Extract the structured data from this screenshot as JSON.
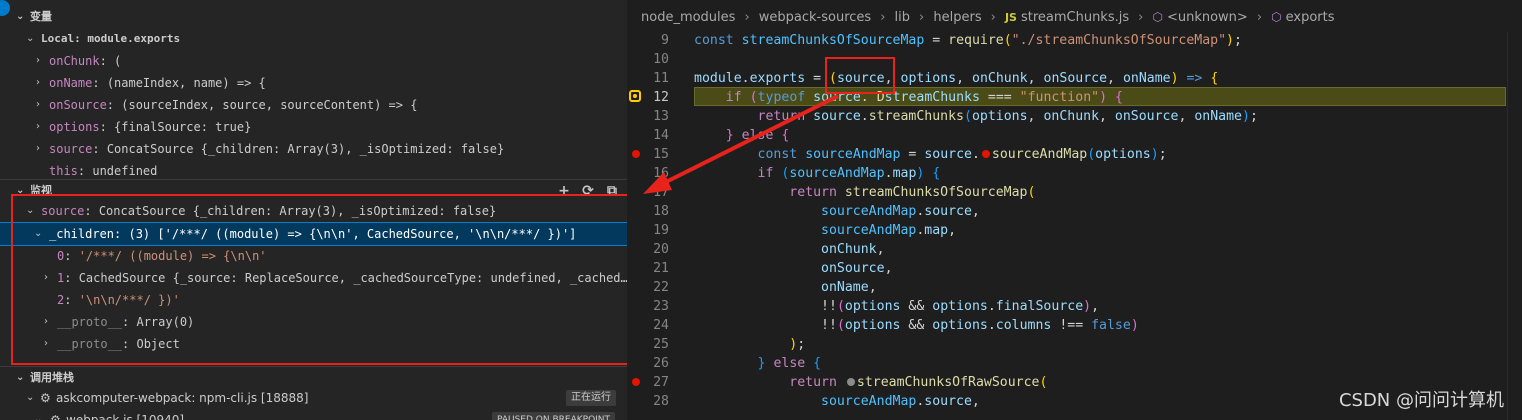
{
  "sidebar": {
    "variables": {
      "title": "变量",
      "scope": "Local: module.exports",
      "items": [
        {
          "name": "onChunk",
          "value": "("
        },
        {
          "name": "onName",
          "value": "(nameIndex, name) => {"
        },
        {
          "name": "onSource",
          "value": "(sourceIndex, source, sourceContent) => {"
        },
        {
          "name": "options",
          "value": "{finalSource: true}"
        },
        {
          "name": "source",
          "value": "ConcatSource {_children: Array(3), _isOptimized: false}"
        },
        {
          "name": "this",
          "value": "undefined"
        }
      ]
    },
    "watch": {
      "title": "监视",
      "items": [
        {
          "name": "source",
          "value": "ConcatSource {_children: Array(3), _isOptimized: false}"
        },
        {
          "name": "_children",
          "value": "(3) ['/***/ ((module) => {\\n\\n', CachedSource, '\\n\\n/***/ })']"
        },
        {
          "name": "0",
          "value": "'/***/ ((module) => {\\n\\n'"
        },
        {
          "name": "1",
          "value": "CachedSource {_source: ReplaceSource, _cachedSourceType: undefined, _cached…"
        },
        {
          "name": "2",
          "value": "'\\n\\n/***/ })'"
        },
        {
          "name": "__proto__",
          "value": "Array(0)"
        },
        {
          "name": "__proto__",
          "value": "Object"
        }
      ]
    },
    "callstack": {
      "title": "调用堆栈",
      "items": [
        {
          "label": "askcomputer-webpack: npm-cli.js [18888]",
          "badge": "正在运行"
        },
        {
          "label": "webpack.js [10940]",
          "badge": "PAUSED ON BREAKPOINT"
        }
      ]
    }
  },
  "editor": {
    "breadcrumb": [
      "node_modules",
      "webpack-sources",
      "lib",
      "helpers",
      "streamChunks.js",
      "<unknown>",
      "exports"
    ],
    "breadcrumb_file_icon": "JS",
    "lines": [
      {
        "n": "9"
      },
      {
        "n": "10"
      },
      {
        "n": "11"
      },
      {
        "n": "12"
      },
      {
        "n": "13"
      },
      {
        "n": "14"
      },
      {
        "n": "15"
      },
      {
        "n": "16"
      },
      {
        "n": "17"
      },
      {
        "n": "18"
      },
      {
        "n": "19"
      },
      {
        "n": "20"
      },
      {
        "n": "21"
      },
      {
        "n": "22"
      },
      {
        "n": "23"
      },
      {
        "n": "24"
      },
      {
        "n": "25"
      },
      {
        "n": "26"
      },
      {
        "n": "27"
      },
      {
        "n": "28"
      }
    ]
  },
  "watermark": "CSDN @问问计算机",
  "colors": {
    "annotation_red": "#e8231c",
    "selection_blue": "#04395e",
    "current_line": "#4b4b18"
  }
}
